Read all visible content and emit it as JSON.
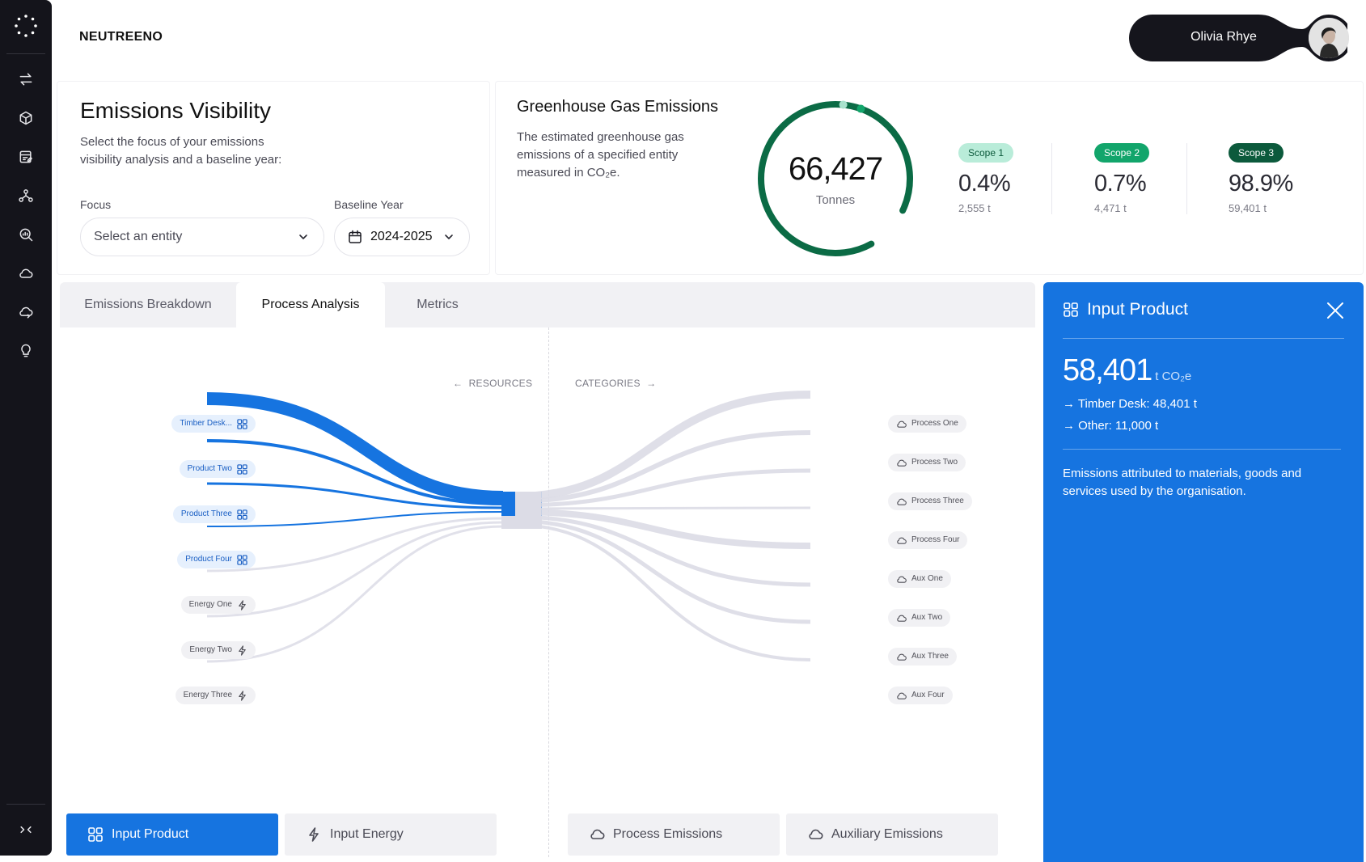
{
  "app": {
    "brand": "NEUTREENO",
    "user_name": "Olivia Rhye"
  },
  "sidebar": {
    "items": [
      {
        "icon": "transfer-icon"
      },
      {
        "icon": "package-icon"
      },
      {
        "icon": "report-edit-icon"
      },
      {
        "icon": "network-icon"
      },
      {
        "icon": "search-analytics-icon"
      },
      {
        "icon": "cloud-icon"
      },
      {
        "icon": "cloud-sync-icon"
      },
      {
        "icon": "lightbulb-icon"
      }
    ],
    "collapse_label": "><"
  },
  "visibility": {
    "title": "Emissions Visibility",
    "description": "Select the focus of your emissions visibility analysis and a baseline year:",
    "focus_label": "Focus",
    "focus_placeholder": "Select an entity",
    "baseline_label": "Baseline Year",
    "baseline_value": "2024-2025"
  },
  "ghg": {
    "title": "Greenhouse Gas Emissions",
    "description": "The estimated greenhouse gas emissions of a specified entity measured in CO₂e.",
    "total": "66,427",
    "unit": "Tonnes",
    "ring_fraction": 0.9,
    "scopes": [
      {
        "label": "Scope 1",
        "pct": "0.4%",
        "tonnes": "2,555 t",
        "badge_bg": "#b9ecd9",
        "badge_fg": "#0c5a3c"
      },
      {
        "label": "Scope 2",
        "pct": "0.7%",
        "tonnes": "4,471 t",
        "badge_bg": "#12a56b",
        "badge_fg": "#ffffff"
      },
      {
        "label": "Scope 3",
        "pct": "98.9%",
        "tonnes": "59,401 t",
        "badge_bg": "#0c5a3c",
        "badge_fg": "#ffffff"
      }
    ]
  },
  "tabs": [
    {
      "label": "Emissions Breakdown",
      "active": false
    },
    {
      "label": "Process Analysis",
      "active": true
    },
    {
      "label": "Metrics",
      "active": false
    }
  ],
  "analysis": {
    "resources_label": "RESOURCES",
    "categories_label": "CATEGORIES",
    "resources": [
      {
        "label": "Timber Desk...",
        "type": "product",
        "highlight": true
      },
      {
        "label": "Product Two",
        "type": "product",
        "highlight": true
      },
      {
        "label": "Product Three",
        "type": "product",
        "highlight": true
      },
      {
        "label": "Product Four",
        "type": "product",
        "highlight": true
      },
      {
        "label": "Energy One",
        "type": "energy",
        "highlight": false
      },
      {
        "label": "Energy Two",
        "type": "energy",
        "highlight": false
      },
      {
        "label": "Energy Three",
        "type": "energy",
        "highlight": false
      }
    ],
    "categories": [
      {
        "label": "Process One"
      },
      {
        "label": "Process Two"
      },
      {
        "label": "Process Three"
      },
      {
        "label": "Process Four"
      },
      {
        "label": "Aux One"
      },
      {
        "label": "Aux Two"
      },
      {
        "label": "Aux Three"
      },
      {
        "label": "Aux Four"
      }
    ],
    "buttons": [
      {
        "label": "Input Product",
        "icon": "grid-icon",
        "active": true
      },
      {
        "label": "Input Energy",
        "icon": "bolt-icon",
        "active": false
      },
      {
        "label": "Process Emissions",
        "icon": "cloud-icon",
        "active": false
      },
      {
        "label": "Auxiliary Emissions",
        "icon": "cloud-icon",
        "active": false
      }
    ]
  },
  "panel": {
    "title": "Input Product",
    "value": "58,401",
    "unit": "t CO₂e",
    "lines": [
      "→ Timber Desk: 48,401 t",
      "→ Other: 11,000 t"
    ],
    "description": "Emissions attributed to materials, goods and services used by the organisation."
  },
  "colors": {
    "accent_blue": "#1674e0",
    "ring_green": "#0b6b45",
    "flow_grey": "#dcdce6"
  }
}
